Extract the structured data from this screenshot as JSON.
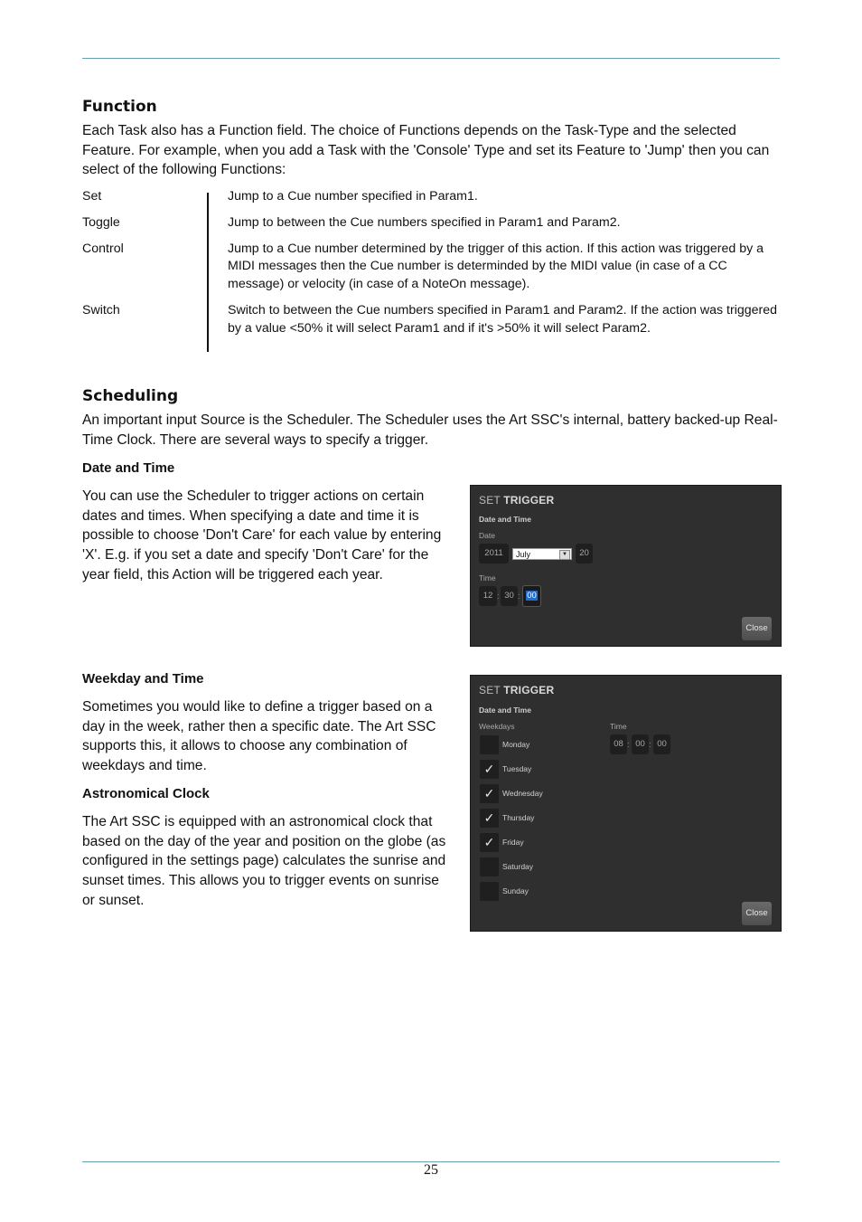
{
  "page_number": "25",
  "function_section": {
    "heading": "Function",
    "intro": "Each Task also has a Function field. The choice of Functions depends on the Task-Type and the selected Feature. For example, when you add a Task with the 'Console' Type and set its Feature to 'Jump' then you can select of the following Functions:",
    "functions": [
      {
        "name": "Set",
        "description": "Jump to a Cue number specified in Param1."
      },
      {
        "name": "Toggle",
        "description": "Jump to between the Cue numbers specified in Param1 and Param2."
      },
      {
        "name": "Control",
        "description": "Jump to a Cue number determined by the trigger of this action. If this action was triggered by a MIDI messages then the Cue number is determinded by the MIDI value (in case of a CC message) or velocity (in case of a NoteOn message)."
      },
      {
        "name": "Switch",
        "description": "Switch to between the Cue numbers specified in Param1 and Param2. If the action was triggered by a value <50% it will select Param1 and if it's >50% it will select Param2."
      }
    ]
  },
  "scheduling_section": {
    "heading": "Scheduling",
    "intro": "An important input Source is the Scheduler. The Scheduler uses the Art SSC's internal, battery backed-up Real-Time Clock. There are several ways to specify a trigger.",
    "date_time": {
      "heading": "Date and Time",
      "text": "You can use the Scheduler to trigger actions on certain dates and times. When specifying a date and time it is possible to choose 'Don't Care' for each value by entering 'X'. E.g. if you set a date and specify 'Don't Care' for the year field, this Action will be triggered each year."
    },
    "weekday_time": {
      "heading": "Weekday and Time",
      "text": "Sometimes you would like to define a trigger based on a day in the week, rather then a specific date. The Art SSC supports this, it allows to choose any combination of weekdays and time."
    },
    "astronomical": {
      "heading": "Astronomical Clock",
      "text": "The Art SSC is equipped with an astronomical clock that based on the day of the year and position on the globe (as configured in the settings page) calculates the sunrise and sunset times. This allows you to trigger events on sunrise or sunset."
    }
  },
  "dialog_date": {
    "title_light": "SET",
    "title_bold": "TRIGGER",
    "subtitle": "Date and Time",
    "date_label": "Date",
    "year": "2011",
    "month": "July",
    "day": "20",
    "time_label": "Time",
    "hour": "12",
    "minute": "30",
    "second": "00",
    "separator": ":",
    "close_label": "Close"
  },
  "dialog_weekday": {
    "title_light": "SET",
    "title_bold": "TRIGGER",
    "subtitle": "Date and Time",
    "weekdays_label": "Weekdays",
    "time_label": "Time",
    "weekdays": [
      {
        "label": "Monday",
        "checked": false
      },
      {
        "label": "Tuesday",
        "checked": true
      },
      {
        "label": "Wednesday",
        "checked": true
      },
      {
        "label": "Thursday",
        "checked": true
      },
      {
        "label": "Friday",
        "checked": true
      },
      {
        "label": "Saturday",
        "checked": false
      },
      {
        "label": "Sunday",
        "checked": false
      }
    ],
    "hour": "08",
    "minute": "00",
    "second": "00",
    "separator": ":",
    "close_label": "Close"
  },
  "colors": {
    "rule": "#3bb4cc",
    "dialog_bg": "#2f2f2f",
    "highlight": "#1e6ed6"
  }
}
